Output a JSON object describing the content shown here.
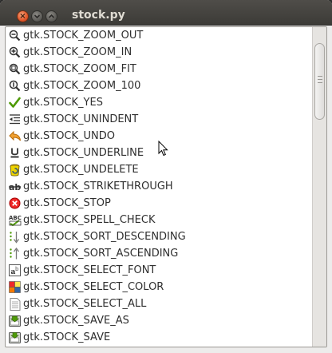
{
  "window": {
    "title": "stock.py",
    "close_glyph": "×",
    "minimize_glyph": "⌄",
    "maximize_glyph": "⌃"
  },
  "items": [
    {
      "label": "gtk.STOCK_ZOOM_OUT",
      "icon": "zoom-out-icon"
    },
    {
      "label": "gtk.STOCK_ZOOM_IN",
      "icon": "zoom-in-icon"
    },
    {
      "label": "gtk.STOCK_ZOOM_FIT",
      "icon": "zoom-fit-icon"
    },
    {
      "label": "gtk.STOCK_ZOOM_100",
      "icon": "zoom-100-icon"
    },
    {
      "label": "gtk.STOCK_YES",
      "icon": "checkmark-icon"
    },
    {
      "label": "gtk.STOCK_UNINDENT",
      "icon": "unindent-icon"
    },
    {
      "label": "gtk.STOCK_UNDO",
      "icon": "undo-arrow-icon"
    },
    {
      "label": "gtk.STOCK_UNDERLINE",
      "icon": "underline-icon"
    },
    {
      "label": "gtk.STOCK_UNDELETE",
      "icon": "undelete-bin-icon"
    },
    {
      "label": "gtk.STOCK_STRIKETHROUGH",
      "icon": "strikethrough-icon"
    },
    {
      "label": "gtk.STOCK_STOP",
      "icon": "stop-icon"
    },
    {
      "label": "gtk.STOCK_SPELL_CHECK",
      "icon": "spell-check-icon"
    },
    {
      "label": "gtk.STOCK_SORT_DESCENDING",
      "icon": "sort-descending-icon"
    },
    {
      "label": "gtk.STOCK_SORT_ASCENDING",
      "icon": "sort-ascending-icon"
    },
    {
      "label": "gtk.STOCK_SELECT_FONT",
      "icon": "select-font-icon"
    },
    {
      "label": "gtk.STOCK_SELECT_COLOR",
      "icon": "select-color-icon"
    },
    {
      "label": "gtk.STOCK_SELECT_ALL",
      "icon": "select-all-icon"
    },
    {
      "label": "gtk.STOCK_SAVE_AS",
      "icon": "save-as-icon"
    },
    {
      "label": "gtk.STOCK_SAVE",
      "icon": "save-icon"
    }
  ],
  "colors": {
    "titlebar": "#3c3b37",
    "close_button": "#e0562a",
    "list_background": "#ffffff",
    "text": "#2e2e2e"
  }
}
